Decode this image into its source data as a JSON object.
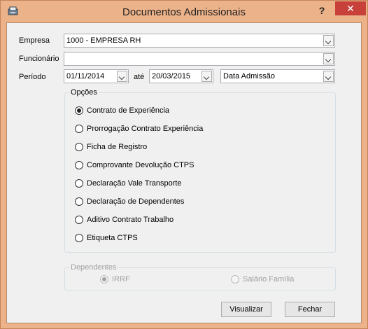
{
  "window": {
    "title": "Documentos Admissionais",
    "help_label": "?",
    "close_label": "✕"
  },
  "form": {
    "empresa_label": "Empresa",
    "empresa_value": "1000 - EMPRESA RH",
    "funcionario_label": "Funcionário",
    "funcionario_value": "",
    "periodo_label": "Período",
    "periodo_start": "01/11/2014",
    "ate_label": "até",
    "periodo_end": "20/03/2015",
    "date_type_value": "Data Admissão"
  },
  "opcoes": {
    "legend": "Opções",
    "selected_index": 0,
    "items": [
      "Contrato de Experiência",
      "Prorrogação Contrato Experiência",
      "Ficha de Registro",
      "Comprovante Devolução CTPS",
      "Declaração Vale Transporte",
      "Declaração de Dependentes",
      "Aditivo Contrato Trabalho",
      "Etiqueta CTPS"
    ]
  },
  "dependentes": {
    "legend": "Dependentes",
    "irrf_label": "IRRF",
    "salario_familia_label": "Salário Família",
    "enabled": false
  },
  "buttons": {
    "visualizar": "Visualizar",
    "fechar": "Fechar"
  },
  "colors": {
    "window_frame": "#ecb289",
    "close_button": "#c7403a",
    "client_bg": "#f0f0f0"
  }
}
